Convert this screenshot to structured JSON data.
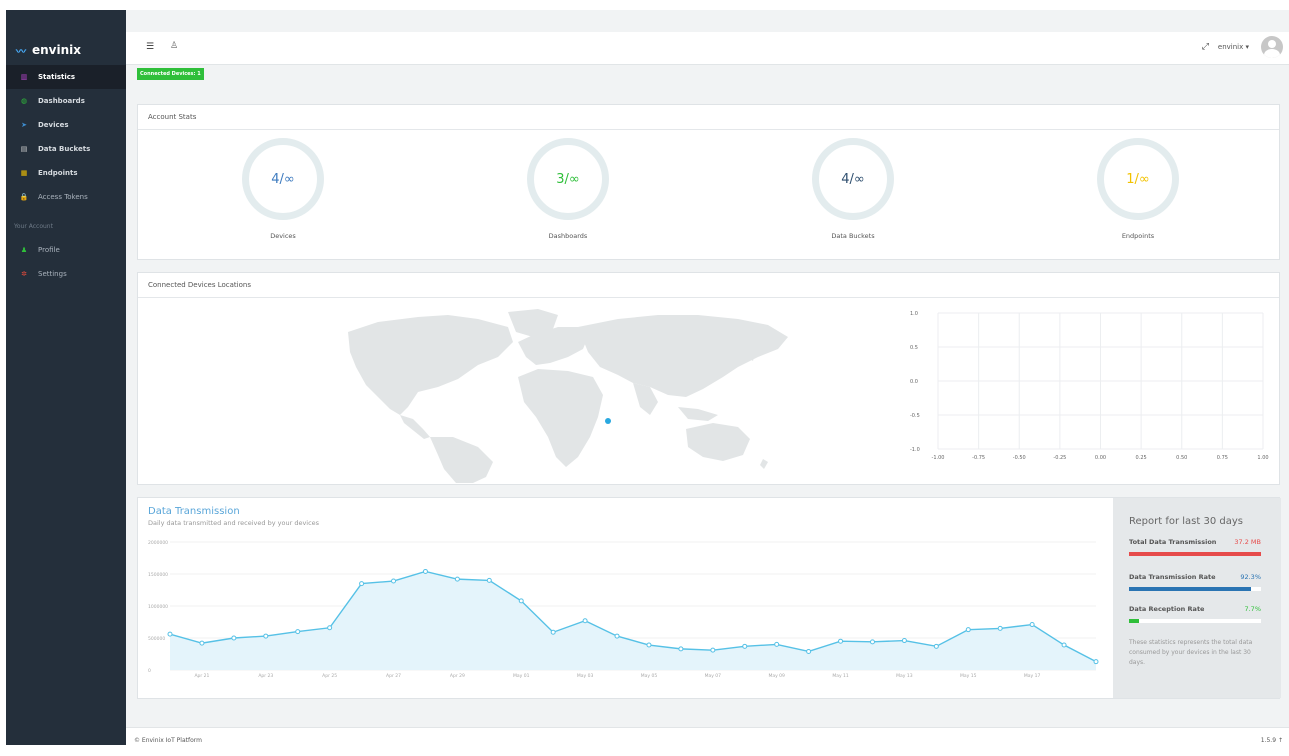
{
  "brand": "envinix",
  "sidebar": {
    "items": [
      {
        "label": "Statistics",
        "icon": "bar-chart-icon",
        "color": "#c047d6"
      },
      {
        "label": "Dashboards",
        "icon": "dashboard-icon",
        "color": "#2fbf3a"
      },
      {
        "label": "Devices",
        "icon": "send-icon",
        "color": "#3e8ed0"
      },
      {
        "label": "Data Buckets",
        "icon": "database-icon",
        "color": "#d0d0d0"
      },
      {
        "label": "Endpoints",
        "icon": "briefcase-icon",
        "color": "#f2c200"
      },
      {
        "label": "Access Tokens",
        "icon": "lock-icon",
        "color": "#2fbf3a"
      }
    ],
    "account_label": "Your Account",
    "account_items": [
      {
        "label": "Profile",
        "icon": "user-icon",
        "color": "#2fbf3a"
      },
      {
        "label": "Settings",
        "icon": "gears-icon",
        "color": "#e64b3c"
      }
    ]
  },
  "topbar": {
    "user": "envinix ▾"
  },
  "connected_badge": "Connected Devices: 1",
  "account_stats": {
    "title": "Account Stats",
    "stats": [
      {
        "value": "4/∞",
        "label": "Devices",
        "color": "#3e7bbf"
      },
      {
        "value": "3/∞",
        "label": "Dashboards",
        "color": "#2fbf3a"
      },
      {
        "value": "4/∞",
        "label": "Data Buckets",
        "color": "#2f4f6f"
      },
      {
        "value": "1/∞",
        "label": "Endpoints",
        "color": "#f2c200"
      }
    ]
  },
  "locations": {
    "title": "Connected Devices Locations",
    "y_ticks": [
      "1.0",
      "0.5",
      "0.0",
      "-0.5",
      "-1.0"
    ],
    "x_ticks": [
      "-1.00",
      "-0.75",
      "-0.50",
      "-0.25",
      "0.00",
      "0.25",
      "0.50",
      "0.75",
      "1.00"
    ]
  },
  "transmission": {
    "title": "Data Transmission",
    "subtitle": "Daily data transmitted and received by your devices"
  },
  "chart_data": {
    "type": "area",
    "y_ticks": [
      "2000000",
      "1500000",
      "1000000",
      "500000",
      "0"
    ],
    "ylim": [
      0,
      2000000
    ],
    "x_labels": [
      "Apr 21",
      "Apr 23",
      "Apr 25",
      "Apr 27",
      "Apr 29",
      "May 01",
      "May 03",
      "May 05",
      "May 07",
      "May 09",
      "May 11",
      "May 13",
      "May 15",
      "May 17"
    ],
    "values": [
      560000,
      420000,
      500000,
      530000,
      600000,
      660000,
      1350000,
      1390000,
      1540000,
      1420000,
      1400000,
      1080000,
      590000,
      770000,
      530000,
      390000,
      330000,
      310000,
      370000,
      400000,
      290000,
      450000,
      440000,
      460000,
      370000,
      630000,
      650000,
      710000,
      390000,
      130000
    ],
    "color": "#56c1e6"
  },
  "report": {
    "title": "Report for last 30 days",
    "rows": [
      {
        "label": "Total Data Transmission",
        "value": "37.2 MB",
        "fraction": 1.0,
        "color": "#e64b4b",
        "value_color": "#e64b4b"
      },
      {
        "label": "Data Transmission Rate",
        "value": "92.3%",
        "fraction": 0.923,
        "color": "#2a74b3",
        "value_color": "#2a74b3"
      },
      {
        "label": "Data Reception Rate",
        "value": "7.7%",
        "fraction": 0.077,
        "color": "#2fbf3a",
        "value_color": "#2fbf3a"
      }
    ],
    "note": "These statistics represents the total data consumed by your devices in the last 30 days."
  },
  "footer": {
    "copyright": "© Envinix IoT Platform",
    "version": "1.5.9"
  }
}
